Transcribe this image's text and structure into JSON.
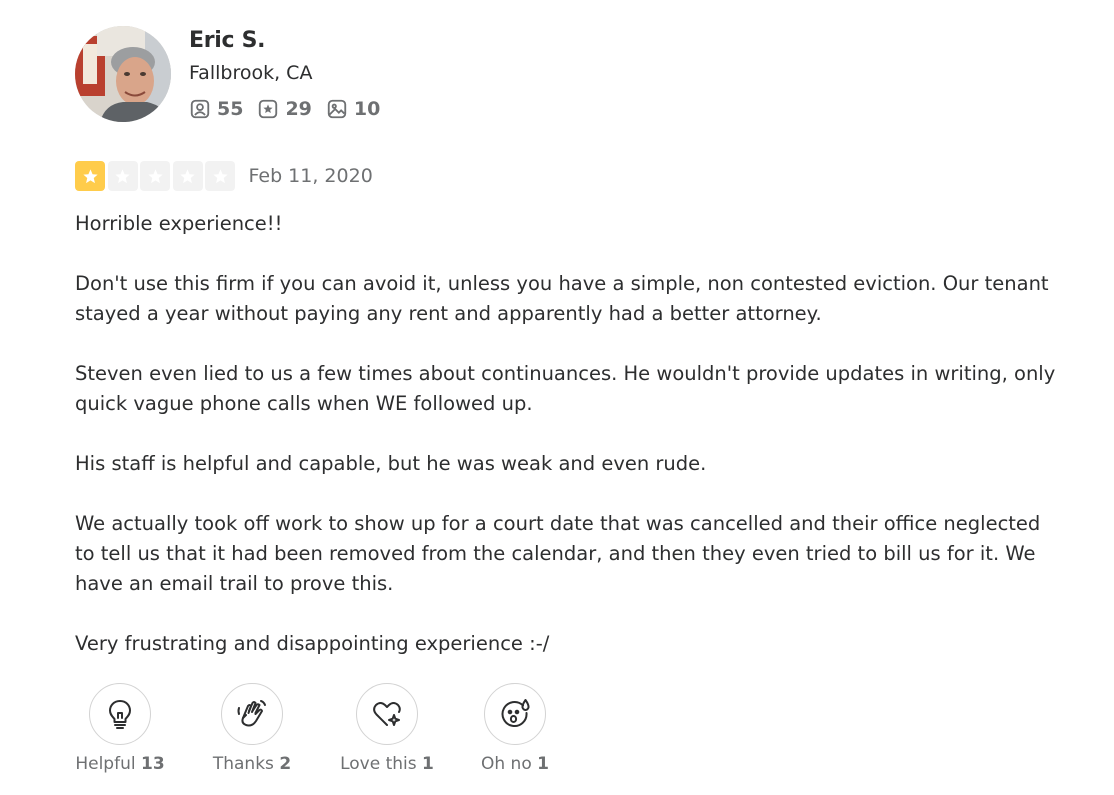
{
  "user": {
    "name": "Eric S.",
    "location": "Fallbrook, CA",
    "stats": [
      {
        "icon": "friends-icon",
        "value": "55"
      },
      {
        "icon": "reviews-star-icon",
        "value": "29"
      },
      {
        "icon": "photos-icon",
        "value": "10"
      }
    ]
  },
  "review": {
    "rating": 1,
    "rating_max": 5,
    "star_color": "#ffcc4b",
    "date": "Feb 11, 2020",
    "paragraphs": [
      "Horrible experience!!",
      "Don't use this firm if you can avoid it, unless you have a simple, non contested eviction. Our tenant stayed a year without paying any rent and apparently had a better attorney.",
      "Steven even lied to us a few times about continuances. He wouldn't provide updates in writing, only quick vague phone calls when WE followed up.",
      "His staff is helpful and capable, but he was weak and even rude.",
      "We actually took off work to show up for a court date that was cancelled and their office neglected to tell us that it had been removed from the calendar, and then they even tried to bill us for it. We have an email trail to prove this.",
      "Very frustrating and disappointing experience :-/"
    ]
  },
  "reactions": [
    {
      "icon": "lightbulb-icon",
      "label": "Helpful",
      "count": "13"
    },
    {
      "icon": "waving-hands-icon",
      "label": "Thanks",
      "count": "2"
    },
    {
      "icon": "heart-sparkle-icon",
      "label": "Love this",
      "count": "1"
    },
    {
      "icon": "surprised-face-icon",
      "label": "Oh no",
      "count": "1"
    }
  ]
}
